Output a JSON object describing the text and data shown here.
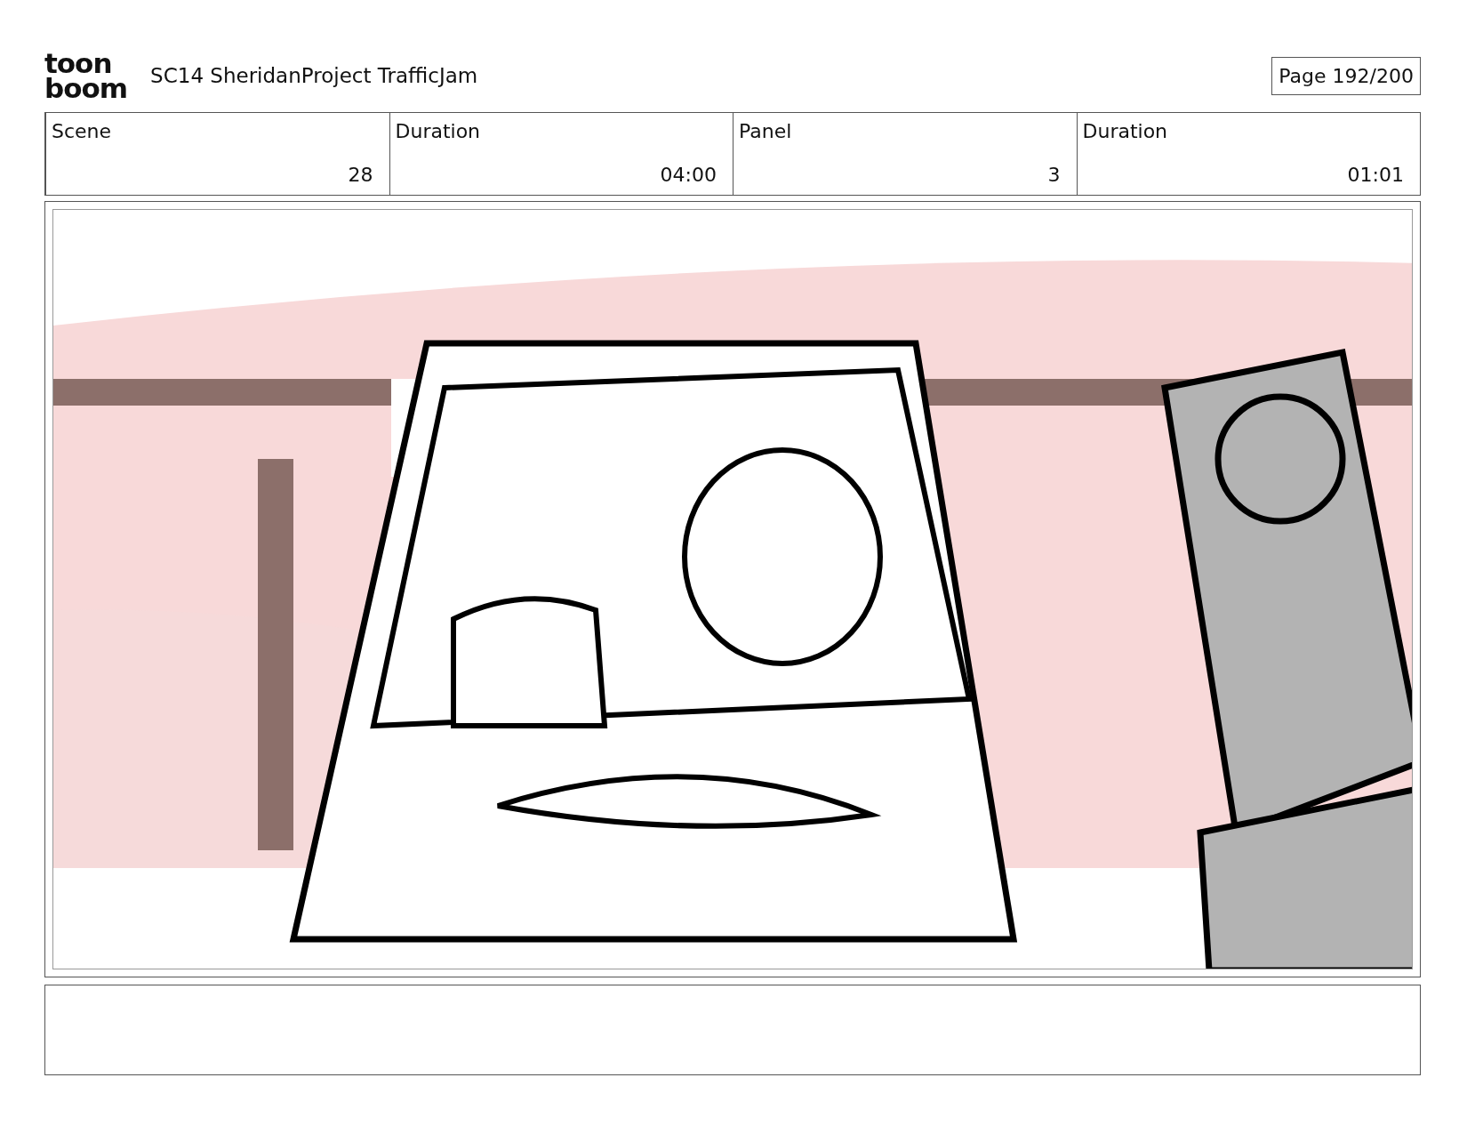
{
  "logo": {
    "lines": [
      "toon",
      "boom"
    ]
  },
  "title": "SC14 SheridanProject TrafficJam",
  "page": "Page 192/200",
  "fields": [
    {
      "label": "Scene",
      "value": "28"
    },
    {
      "label": "Duration",
      "value": "04:00"
    },
    {
      "label": "Panel",
      "value": "3"
    },
    {
      "label": "Duration",
      "value": "01:01"
    }
  ]
}
